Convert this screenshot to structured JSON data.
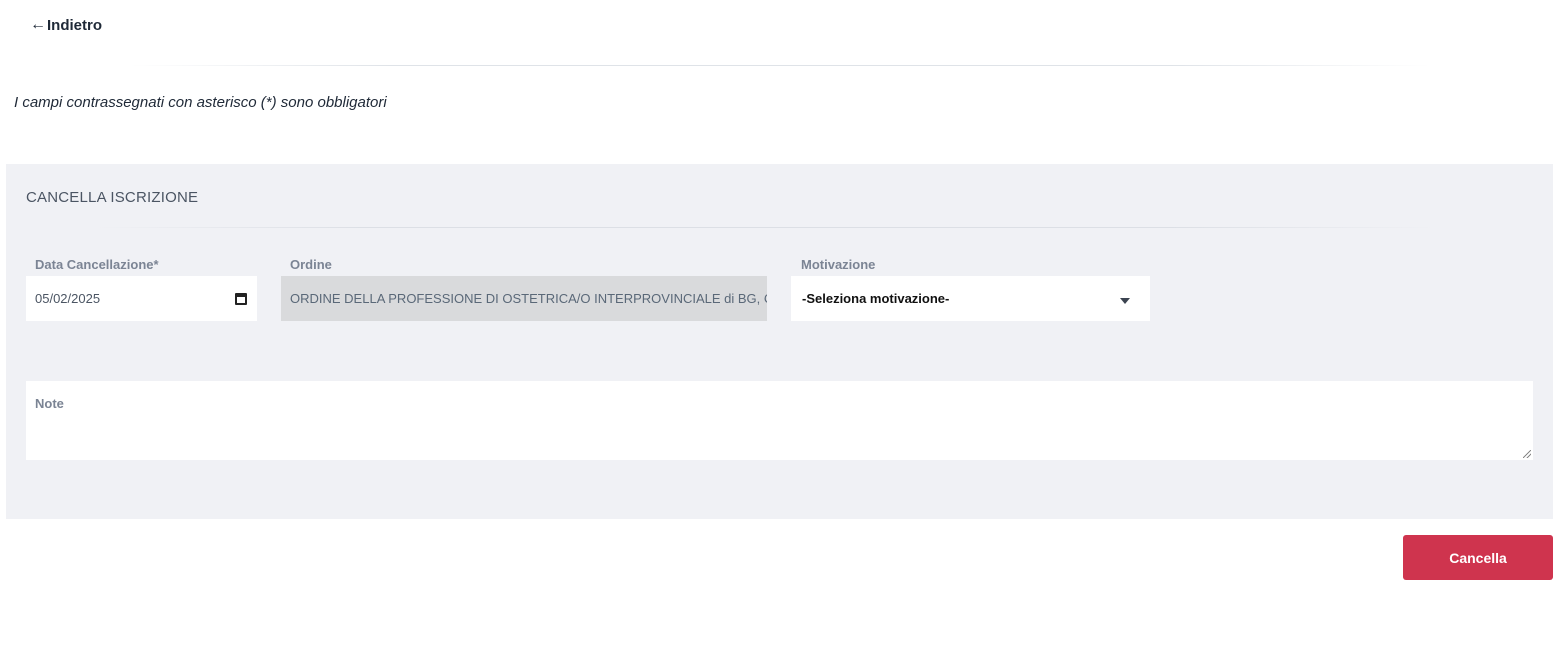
{
  "back": {
    "arrow": "←",
    "label": "Indietro"
  },
  "required_note": "I campi contrassegnati con asterisco (*) sono obbligatori",
  "panel": {
    "title": "CANCELLA ISCRIZIONE",
    "fields": {
      "data_cancellazione": {
        "label": "Data Cancellazione*",
        "value": "05/02/2025",
        "icon": "calendar-icon"
      },
      "ordine": {
        "label": "Ordine",
        "value": "ORDINE DELLA PROFESSIONE DI OSTETRICA/O INTERPROVINCIALE di BG, CR, LO, MI e MB"
      },
      "motivazione": {
        "label": "Motivazione",
        "selected": "-Seleziona motivazione-",
        "icon": "caret-down-icon"
      },
      "note": {
        "label": "Note",
        "value": ""
      }
    }
  },
  "actions": {
    "cancel_label": "Cancella"
  },
  "colors": {
    "panel_bg": "#f0f1f5",
    "disabled_bg": "#d9dadc",
    "danger": "#cf344e",
    "label": "#7b8494"
  }
}
